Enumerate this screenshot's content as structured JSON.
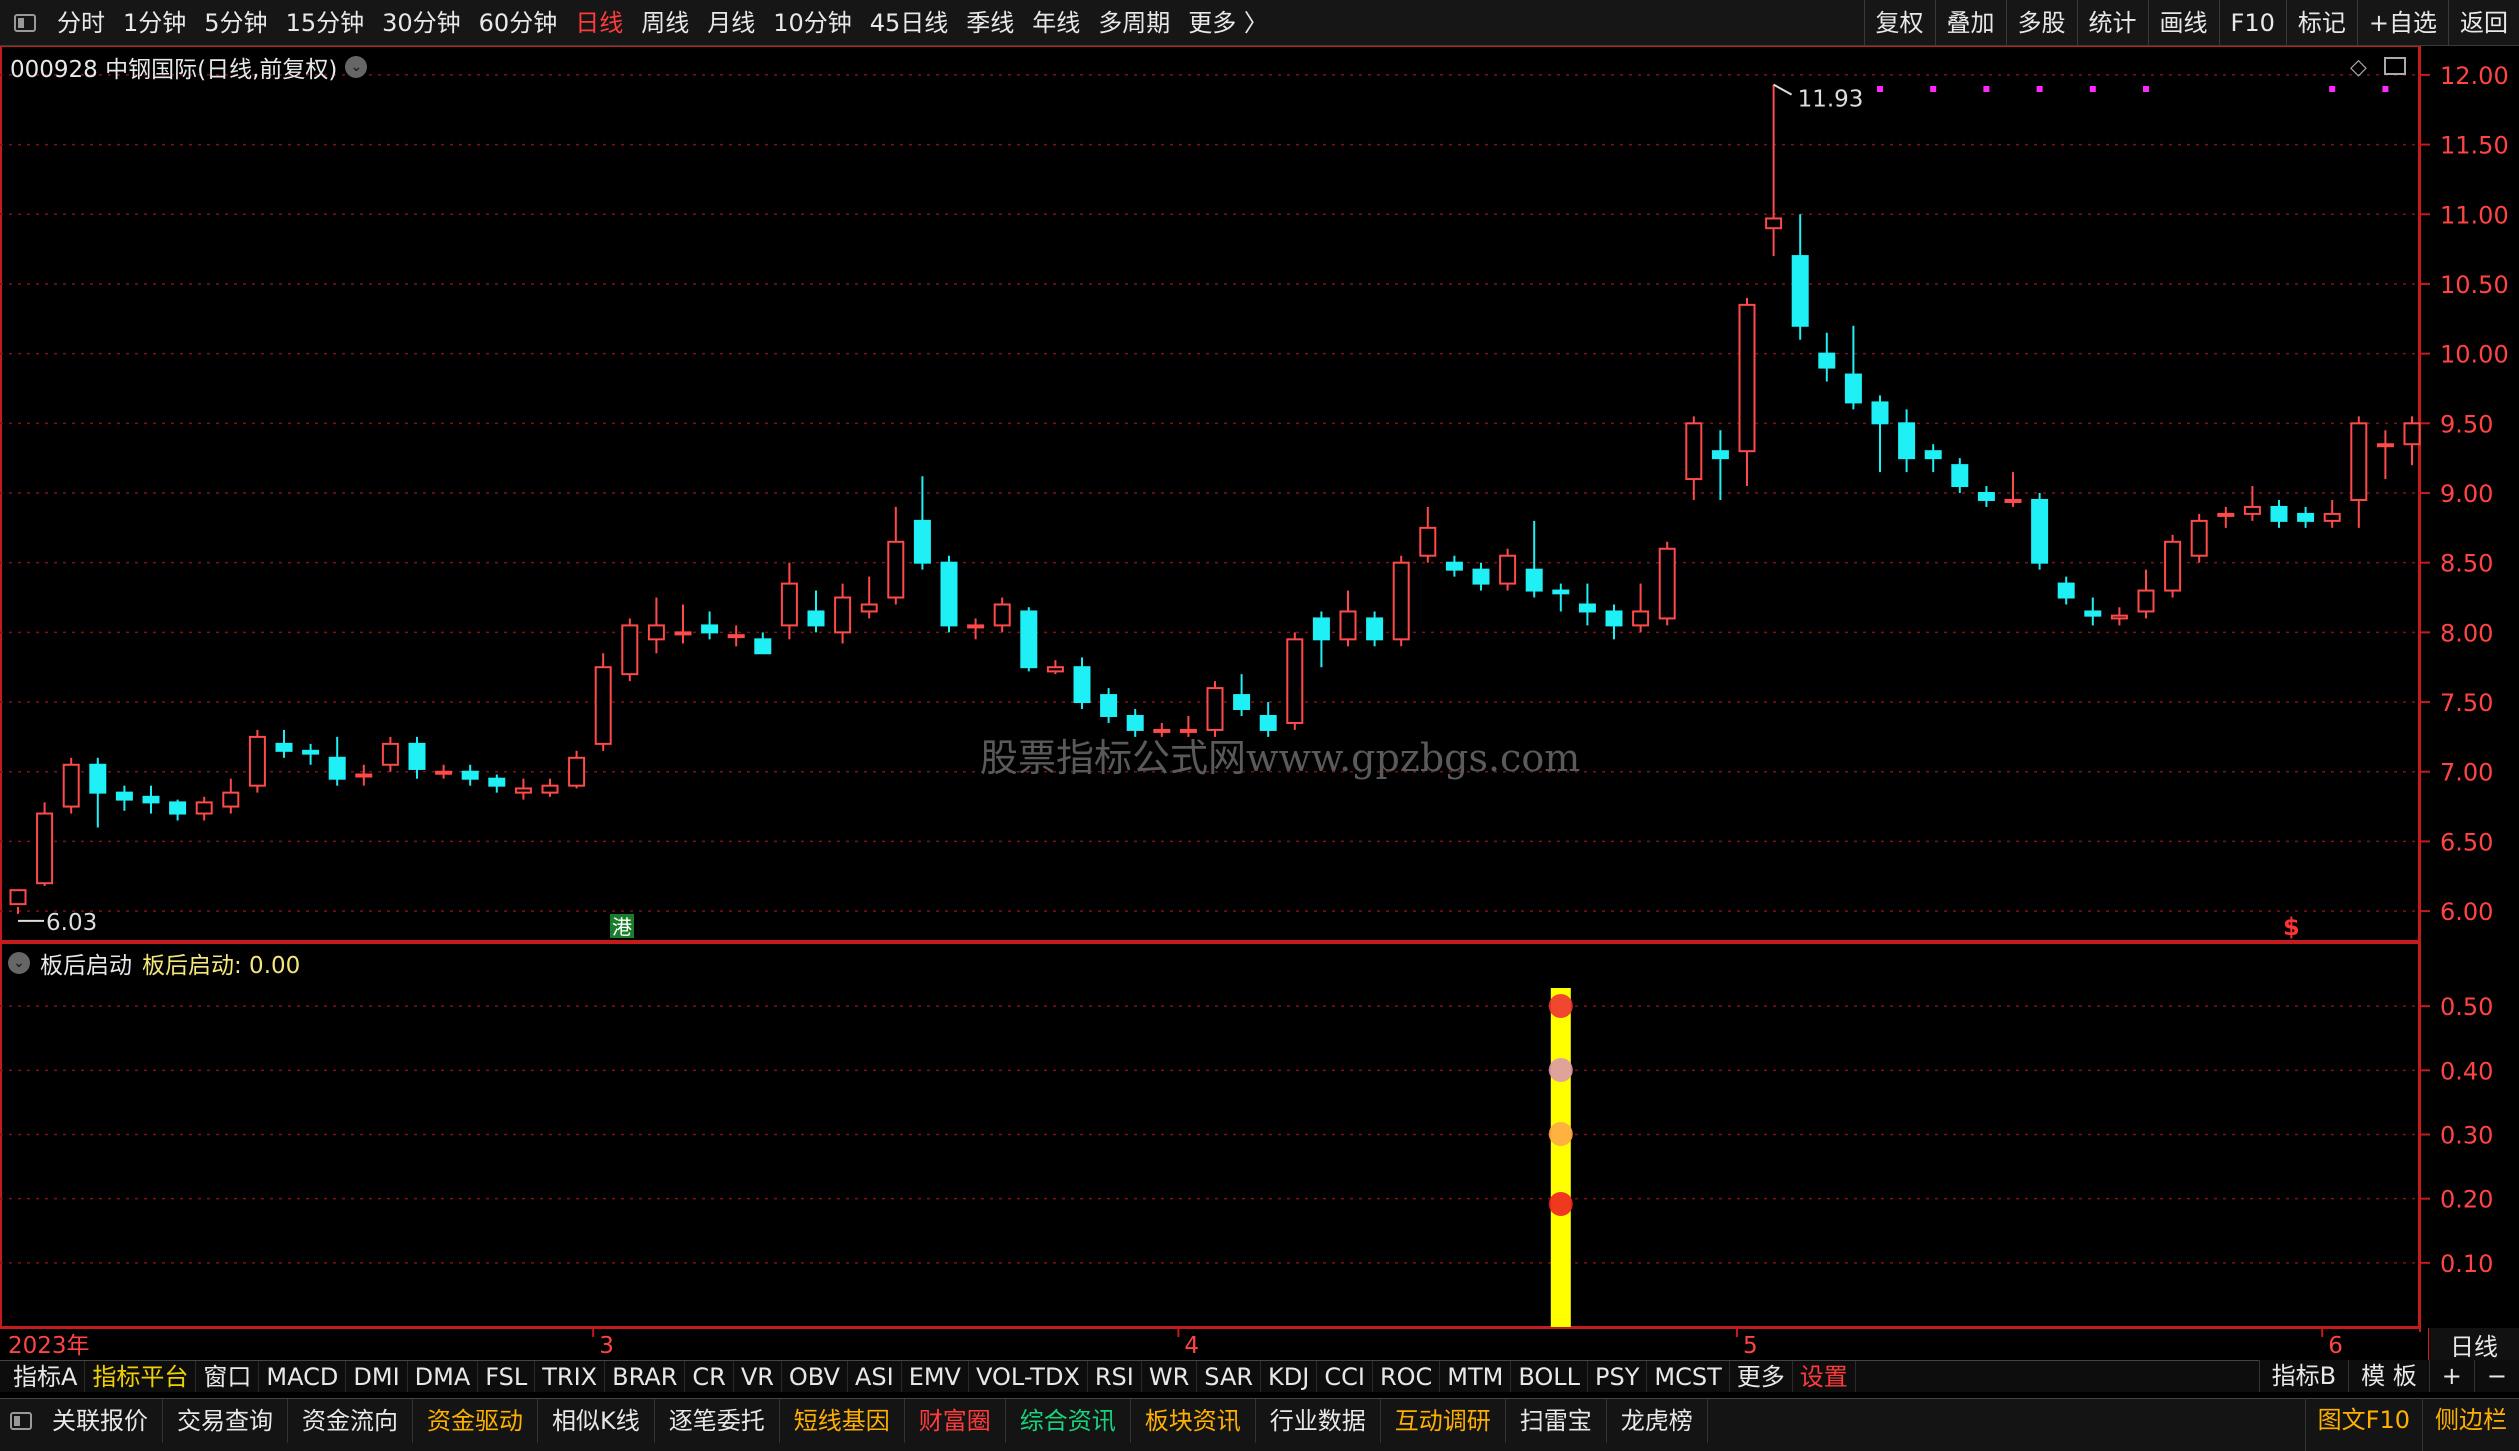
{
  "top_tabs": [
    "分时",
    "1分钟",
    "5分钟",
    "15分钟",
    "30分钟",
    "60分钟",
    "日线",
    "周线",
    "月线",
    "10分钟",
    "45日线",
    "季线",
    "年线",
    "多周期",
    "更多 〉"
  ],
  "active_tab": "日线",
  "top_right": [
    "复权",
    "叠加",
    "多股",
    "统计",
    "画线",
    "F10",
    "标记",
    "+自选",
    "返回"
  ],
  "stock_title": "000928 中钢国际(日线,前复权)",
  "price_axis": [
    "12.00",
    "11.50",
    "11.00",
    "10.50",
    "10.00",
    "9.50",
    "9.00",
    "8.50",
    "8.00",
    "7.50",
    "7.00",
    "6.50",
    "6.00"
  ],
  "max_label": "11.93",
  "min_label": "6.03",
  "watermark": "股票指标公式网www.gpzbgs.com",
  "hk_badge": "港",
  "s_badge": "$",
  "sub_title": "板后启动",
  "sub_value_label": "板后启动: 0.00",
  "sub_axis": [
    "0.50",
    "0.40",
    "0.30",
    "0.20",
    "0.10"
  ],
  "time_labels": [
    "2023年",
    "3",
    "4",
    "5",
    "6"
  ],
  "period": "日线",
  "indicator_tabs": [
    "指标A",
    "指标平台",
    "窗口",
    "MACD",
    "DMI",
    "DMA",
    "FSL",
    "TRIX",
    "BRAR",
    "CR",
    "VR",
    "OBV",
    "ASI",
    "EMV",
    "VOL-TDX",
    "RSI",
    "WR",
    "SAR",
    "KDJ",
    "CCI",
    "ROC",
    "MTM",
    "BOLL",
    "PSY",
    "MCST",
    "更多",
    "设置"
  ],
  "indicator_right": [
    "指标B",
    "模 板",
    "+",
    "−"
  ],
  "bottom_tabs": [
    "关联报价",
    "交易查询",
    "资金流向",
    "资金驱动",
    "相似K线",
    "逐笔委托",
    "短线基因",
    "财富圈",
    "综合资讯",
    "板块资讯",
    "行业数据",
    "互动调研",
    "扫雷宝",
    "龙虎榜"
  ],
  "bottom_right": [
    "图文F10",
    "侧边栏"
  ],
  "colors": {
    "up": "#ff4a4a",
    "down": "#1ff0f5",
    "grid": "#7a1515",
    "axis": "#c41c1c",
    "signal": "#ffff00",
    "marker": "#ff28ff"
  },
  "chart_data": {
    "type": "candlestick",
    "ylim": [
      5.85,
      12.15
    ],
    "candles": [
      [
        6.05,
        6.15,
        6.03,
        5.98
      ],
      [
        6.2,
        6.7,
        6.78,
        6.18
      ],
      [
        6.75,
        7.05,
        7.1,
        6.7
      ],
      [
        7.05,
        6.85,
        7.1,
        6.6
      ],
      [
        6.85,
        6.8,
        6.9,
        6.72
      ],
      [
        6.82,
        6.78,
        6.9,
        6.7
      ],
      [
        6.78,
        6.7,
        6.8,
        6.65
      ],
      [
        6.7,
        6.78,
        6.82,
        6.65
      ],
      [
        6.75,
        6.85,
        6.95,
        6.7
      ],
      [
        6.9,
        7.25,
        7.3,
        6.85
      ],
      [
        7.2,
        7.15,
        7.3,
        7.1
      ],
      [
        7.15,
        7.13,
        7.2,
        7.05
      ],
      [
        7.1,
        6.95,
        7.25,
        6.9
      ],
      [
        6.98,
        6.98,
        7.05,
        6.9
      ],
      [
        7.05,
        7.2,
        7.25,
        7.0
      ],
      [
        7.2,
        7.02,
        7.25,
        6.95
      ],
      [
        7.0,
        7.0,
        7.05,
        6.95
      ],
      [
        7.0,
        6.95,
        7.05,
        6.9
      ],
      [
        6.95,
        6.9,
        6.98,
        6.85
      ],
      [
        6.85,
        6.88,
        6.95,
        6.8
      ],
      [
        6.85,
        6.9,
        6.95,
        6.82
      ],
      [
        6.9,
        7.1,
        7.15,
        6.88
      ],
      [
        7.2,
        7.75,
        7.85,
        7.15
      ],
      [
        7.7,
        8.05,
        8.1,
        7.65
      ],
      [
        7.95,
        8.05,
        8.25,
        7.85
      ],
      [
        8.0,
        8.0,
        8.2,
        7.92
      ],
      [
        8.05,
        8.0,
        8.15,
        7.95
      ],
      [
        7.98,
        7.98,
        8.05,
        7.9
      ],
      [
        7.95,
        7.85,
        8.0,
        7.85
      ],
      [
        8.05,
        8.35,
        8.5,
        7.95
      ],
      [
        8.15,
        8.05,
        8.3,
        8.0
      ],
      [
        8.0,
        8.25,
        8.35,
        7.92
      ],
      [
        8.15,
        8.2,
        8.4,
        8.1
      ],
      [
        8.25,
        8.65,
        8.9,
        8.2
      ],
      [
        8.8,
        8.5,
        9.12,
        8.45
      ],
      [
        8.5,
        8.05,
        8.55,
        8.0
      ],
      [
        8.05,
        8.05,
        8.1,
        7.95
      ],
      [
        8.05,
        8.2,
        8.25,
        8.0
      ],
      [
        8.15,
        7.75,
        8.18,
        7.72
      ],
      [
        7.72,
        7.75,
        7.8,
        7.7
      ],
      [
        7.75,
        7.5,
        7.82,
        7.45
      ],
      [
        7.55,
        7.4,
        7.6,
        7.35
      ],
      [
        7.4,
        7.3,
        7.45,
        7.25
      ],
      [
        7.3,
        7.3,
        7.35,
        7.25
      ],
      [
        7.3,
        7.3,
        7.4,
        7.25
      ],
      [
        7.3,
        7.6,
        7.65,
        7.25
      ],
      [
        7.55,
        7.45,
        7.7,
        7.4
      ],
      [
        7.4,
        7.3,
        7.5,
        7.25
      ],
      [
        7.35,
        7.95,
        8.0,
        7.3
      ],
      [
        8.1,
        7.95,
        8.15,
        7.75
      ],
      [
        7.95,
        8.15,
        8.3,
        7.9
      ],
      [
        8.1,
        7.95,
        8.15,
        7.9
      ],
      [
        7.95,
        8.5,
        8.55,
        7.9
      ],
      [
        8.55,
        8.75,
        8.9,
        8.5
      ],
      [
        8.5,
        8.45,
        8.55,
        8.4
      ],
      [
        8.45,
        8.35,
        8.5,
        8.3
      ],
      [
        8.35,
        8.55,
        8.6,
        8.3
      ],
      [
        8.45,
        8.3,
        8.8,
        8.25
      ],
      [
        8.3,
        8.28,
        8.35,
        8.15
      ],
      [
        8.2,
        8.15,
        8.35,
        8.05
      ],
      [
        8.15,
        8.05,
        8.2,
        7.95
      ],
      [
        8.05,
        8.15,
        8.35,
        8.0
      ],
      [
        8.1,
        8.6,
        8.65,
        8.05
      ],
      [
        9.1,
        9.5,
        9.55,
        8.95
      ],
      [
        9.3,
        9.25,
        9.45,
        8.95
      ],
      [
        9.3,
        10.35,
        10.4,
        9.05
      ],
      [
        10.9,
        10.97,
        11.93,
        10.7
      ],
      [
        10.7,
        10.2,
        11.0,
        10.1
      ],
      [
        10.0,
        9.9,
        10.15,
        9.8
      ],
      [
        9.85,
        9.65,
        10.2,
        9.6
      ],
      [
        9.65,
        9.5,
        9.7,
        9.15
      ],
      [
        9.5,
        9.25,
        9.6,
        9.15
      ],
      [
        9.3,
        9.25,
        9.35,
        9.15
      ],
      [
        9.2,
        9.05,
        9.25,
        9.0
      ],
      [
        9.0,
        8.95,
        9.05,
        8.9
      ],
      [
        8.95,
        8.95,
        9.15,
        8.9
      ],
      [
        8.95,
        8.5,
        9.0,
        8.45
      ],
      [
        8.35,
        8.25,
        8.4,
        8.2
      ],
      [
        8.15,
        8.12,
        8.25,
        8.05
      ],
      [
        8.1,
        8.12,
        8.18,
        8.05
      ],
      [
        8.15,
        8.3,
        8.45,
        8.1
      ],
      [
        8.3,
        8.65,
        8.7,
        8.25
      ],
      [
        8.55,
        8.8,
        8.85,
        8.5
      ],
      [
        8.85,
        8.85,
        8.9,
        8.75
      ],
      [
        8.85,
        8.9,
        9.05,
        8.8
      ],
      [
        8.9,
        8.8,
        8.95,
        8.75
      ],
      [
        8.85,
        8.8,
        8.9,
        8.75
      ],
      [
        8.8,
        8.85,
        8.95,
        8.75
      ],
      [
        8.95,
        9.5,
        9.55,
        8.75
      ],
      [
        9.35,
        9.35,
        9.45,
        9.1
      ],
      [
        9.35,
        9.5,
        9.55,
        9.2
      ]
    ],
    "signal_index": 58,
    "markers_from_index": 70
  }
}
